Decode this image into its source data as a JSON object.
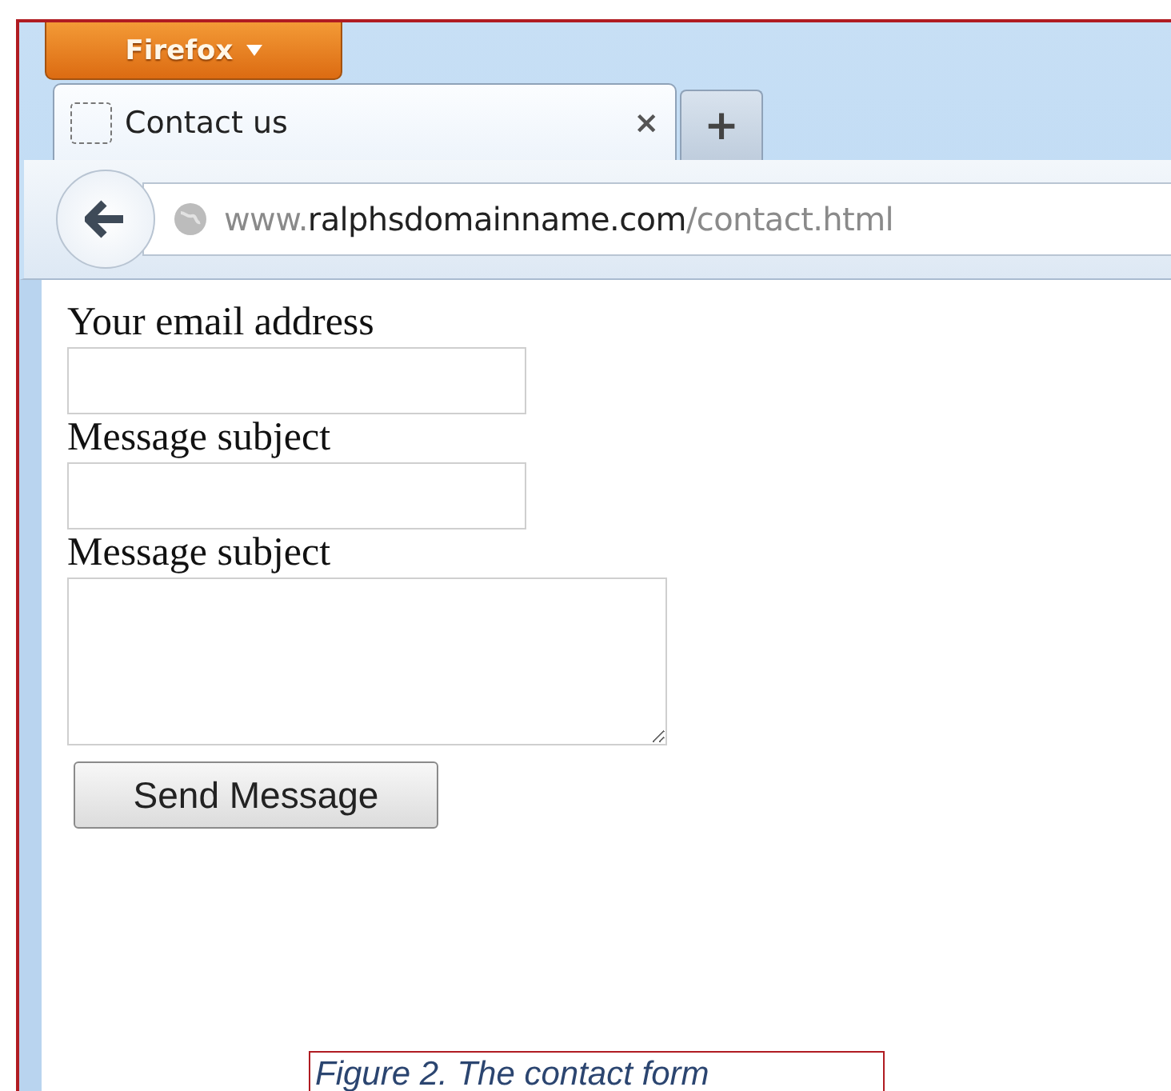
{
  "browser": {
    "menu_button": "Firefox",
    "tabs": [
      {
        "title": "Contact us",
        "close": "×",
        "selected": true
      }
    ],
    "new_tab": "+",
    "address": {
      "prefix": "www.",
      "host": "ralphsdomainname.com",
      "path": "/contact.html"
    }
  },
  "form": {
    "fields": [
      {
        "label": "Your email address",
        "kind": "input"
      },
      {
        "label": "Message subject",
        "kind": "input"
      },
      {
        "label": "Message subject",
        "kind": "textarea"
      }
    ],
    "submit": "Send Message"
  },
  "caption": "Figure 2. The contact form"
}
